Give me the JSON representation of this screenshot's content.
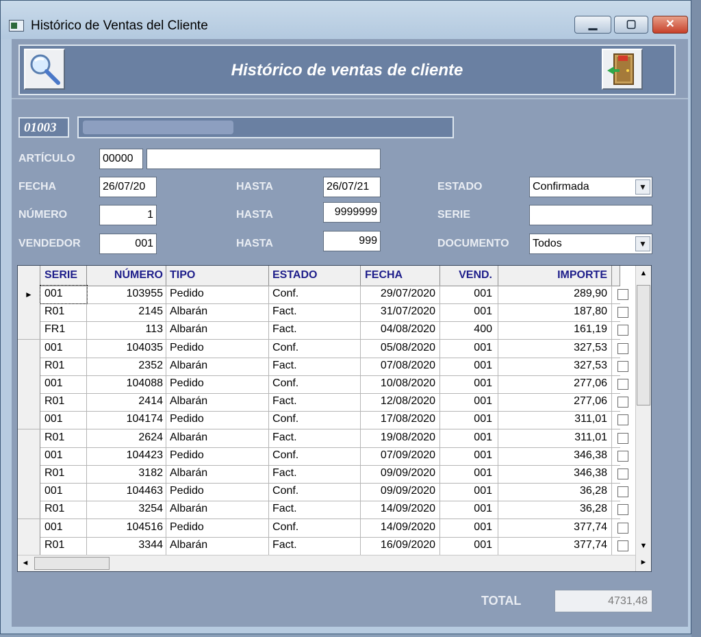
{
  "window": {
    "title": "Histórico de Ventas del Cliente",
    "min_glyph": "▁",
    "max_glyph": "▢",
    "close_glyph": "✕"
  },
  "header": {
    "title": "Histórico de ventas de cliente"
  },
  "client": {
    "code": "01003"
  },
  "filters": {
    "articulo_label": "ARTÍCULO",
    "articulo_code": "00000",
    "articulo_desc": "",
    "fecha_label": "FECHA",
    "fecha_from": "26/07/20",
    "fecha_hasta_label": "HASTA",
    "fecha_to": "26/07/21",
    "estado_label": "ESTADO",
    "estado_value": "Confirmada",
    "numero_label": "NÚMERO",
    "numero_from": "1",
    "numero_hasta_label": "HASTA",
    "numero_to": "9999999",
    "serie_label": "SERIE",
    "serie_value": "",
    "vendedor_label": "VENDEDOR",
    "vendedor_from": "001",
    "vendedor_hasta_label": "HASTA",
    "vendedor_to": "999",
    "documento_label": "DOCUMENTO",
    "documento_value": "Todos",
    "dropdown_glyph": "▼"
  },
  "table": {
    "columns": [
      "SERIE",
      "NÚMERO",
      "TIPO",
      "ESTADO",
      "FECHA",
      "VEND.",
      "IMPORTE"
    ],
    "current_row_marker": "►",
    "rows": [
      [
        "001",
        "103955",
        "Pedido",
        "Conf.",
        "29/07/2020",
        "001",
        "289,90"
      ],
      [
        "R01",
        "2145",
        "Albarán",
        "Fact.",
        "31/07/2020",
        "001",
        "187,80"
      ],
      [
        "FR1",
        "113",
        "Albarán",
        "Fact.",
        "04/08/2020",
        "400",
        "161,19"
      ],
      [
        "001",
        "104035",
        "Pedido",
        "Conf.",
        "05/08/2020",
        "001",
        "327,53"
      ],
      [
        "R01",
        "2352",
        "Albarán",
        "Fact.",
        "07/08/2020",
        "001",
        "327,53"
      ],
      [
        "001",
        "104088",
        "Pedido",
        "Conf.",
        "10/08/2020",
        "001",
        "277,06"
      ],
      [
        "R01",
        "2414",
        "Albarán",
        "Fact.",
        "12/08/2020",
        "001",
        "277,06"
      ],
      [
        "001",
        "104174",
        "Pedido",
        "Conf.",
        "17/08/2020",
        "001",
        "311,01"
      ],
      [
        "R01",
        "2624",
        "Albarán",
        "Fact.",
        "19/08/2020",
        "001",
        "311,01"
      ],
      [
        "001",
        "104423",
        "Pedido",
        "Conf.",
        "07/09/2020",
        "001",
        "346,38"
      ],
      [
        "R01",
        "3182",
        "Albarán",
        "Fact.",
        "09/09/2020",
        "001",
        "346,38"
      ],
      [
        "001",
        "104463",
        "Pedido",
        "Conf.",
        "09/09/2020",
        "001",
        "36,28"
      ],
      [
        "R01",
        "3254",
        "Albarán",
        "Fact.",
        "14/09/2020",
        "001",
        "36,28"
      ],
      [
        "001",
        "104516",
        "Pedido",
        "Conf.",
        "14/09/2020",
        "001",
        "377,74"
      ],
      [
        "R01",
        "3344",
        "Albarán",
        "Fact.",
        "16/09/2020",
        "001",
        "377,74"
      ]
    ]
  },
  "scrollbar": {
    "up": "▲",
    "down": "▼",
    "left": "◄",
    "right": "►"
  },
  "totals": {
    "label": "TOTAL",
    "value": "4731,48"
  }
}
